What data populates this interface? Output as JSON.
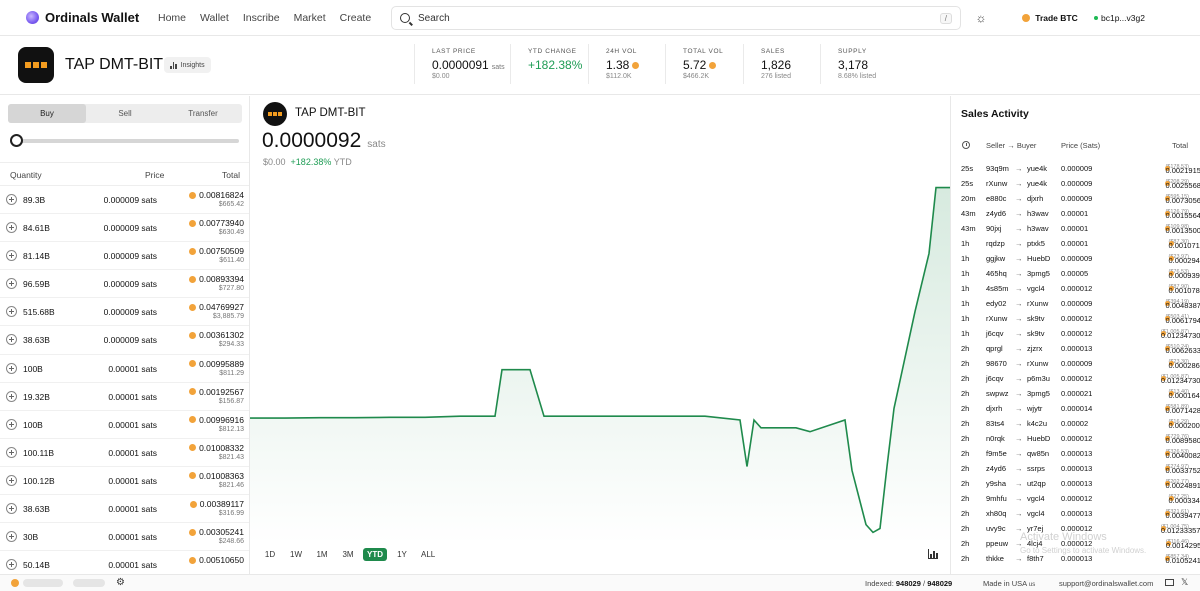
{
  "nav": {
    "brand": "Ordinals Wallet",
    "links": [
      "Home",
      "Wallet",
      "Inscribe",
      "Market",
      "Create"
    ],
    "search_placeholder": "Search",
    "search_shortcut": "/",
    "trade_label": "Trade BTC",
    "wallet_address": "bc1p...v3g2"
  },
  "token": {
    "name": "TAP DMT-BIT",
    "insights_label": "Insights"
  },
  "stats": [
    {
      "label": "LAST PRICE",
      "value": "0.0000091",
      "unit": "sats",
      "sub": "$0.00"
    },
    {
      "label": "YTD CHANGE",
      "value": "+182.38%",
      "unit": "",
      "sub": ""
    },
    {
      "label": "24H VOL",
      "value": "1.38",
      "unit": "",
      "sub": "$112.0K"
    },
    {
      "label": "TOTAL VOL",
      "value": "5.72",
      "unit": "",
      "sub": "$466.2K"
    },
    {
      "label": "SALES",
      "value": "1,826",
      "unit": "",
      "sub": "276 listed"
    },
    {
      "label": "SUPPLY",
      "value": "3,178",
      "unit": "",
      "sub": "8.68% listed"
    }
  ],
  "trade_tabs": [
    "Buy",
    "Sell",
    "Transfer"
  ],
  "orderbook": {
    "headers": {
      "quantity": "Quantity",
      "price": "Price",
      "total": "Total"
    },
    "rows": [
      {
        "qty": "89.3B",
        "price": "0.000009 sats",
        "total": "0.00816824",
        "usd": "$665.42"
      },
      {
        "qty": "84.61B",
        "price": "0.000009 sats",
        "total": "0.00773940",
        "usd": "$630.49"
      },
      {
        "qty": "81.14B",
        "price": "0.000009 sats",
        "total": "0.00750509",
        "usd": "$611.40"
      },
      {
        "qty": "96.59B",
        "price": "0.000009 sats",
        "total": "0.00893394",
        "usd": "$727.80"
      },
      {
        "qty": "515.68B",
        "price": "0.000009 sats",
        "total": "0.04769927",
        "usd": "$3,885.79"
      },
      {
        "qty": "38.63B",
        "price": "0.000009 sats",
        "total": "0.00361302",
        "usd": "$294.33"
      },
      {
        "qty": "100B",
        "price": "0.00001 sats",
        "total": "0.00995889",
        "usd": "$811.29"
      },
      {
        "qty": "19.32B",
        "price": "0.00001 sats",
        "total": "0.00192567",
        "usd": "$156.87"
      },
      {
        "qty": "100B",
        "price": "0.00001 sats",
        "total": "0.00996916",
        "usd": "$812.13"
      },
      {
        "qty": "100.11B",
        "price": "0.00001 sats",
        "total": "0.01008332",
        "usd": "$821.43"
      },
      {
        "qty": "100.12B",
        "price": "0.00001 sats",
        "total": "0.01008363",
        "usd": "$821.46"
      },
      {
        "qty": "38.63B",
        "price": "0.00001 sats",
        "total": "0.00389117",
        "usd": "$316.99"
      },
      {
        "qty": "30B",
        "price": "0.00001 sats",
        "total": "0.00305241",
        "usd": "$248.66"
      },
      {
        "qty": "50.14B",
        "price": "0.00001 sats",
        "total": "0.00510650",
        "usd": ""
      }
    ]
  },
  "chart": {
    "title": "TAP DMT-BIT",
    "price": "0.0000092",
    "unit": "sats",
    "usd": "$0.00",
    "change": "+182.38%",
    "change_suffix": "YTD",
    "ranges": [
      "1D",
      "1W",
      "1M",
      "3M",
      "YTD",
      "1Y",
      "ALL"
    ],
    "active_range": "YTD",
    "line_color": "#1f8a4c"
  },
  "chart_data": {
    "type": "area",
    "x": [
      0,
      5,
      10,
      15,
      20,
      25,
      30,
      35,
      36,
      40,
      42,
      45,
      47,
      50,
      55,
      60,
      65,
      70,
      71,
      72,
      73,
      74,
      75,
      78,
      80,
      85,
      86,
      87,
      88,
      89,
      90,
      91,
      92,
      95,
      97,
      98,
      99,
      100
    ],
    "values": [
      3.25e-06,
      3.25e-06,
      3.26e-06,
      3.26e-06,
      3.27e-06,
      3.27e-06,
      3.3e-06,
      3.3e-06,
      4.5e-06,
      4.5e-06,
      3.3e-06,
      3.3e-06,
      3.3e-06,
      3.3e-06,
      3.3e-06,
      3.3e-06,
      3.3e-06,
      3.2e-06,
      2e-06,
      3.2e-06,
      3e-06,
      3e-06,
      3e-06,
      3e-06,
      2.9e-06,
      3.2e-06,
      1.9e-06,
      1.2e-06,
      5e-07,
      3e-07,
      4e-07,
      2e-06,
      3.5e-06,
      6e-06,
      7.5e-06,
      9.2e-06,
      9.2e-06,
      9.2e-06
    ],
    "xlim": [
      0,
      100
    ],
    "ylim": [
      0,
      9.5e-06
    ],
    "grid": false,
    "legend": "none"
  },
  "sales": {
    "title": "Sales Activity",
    "headers": {
      "seller_buyer": "Seller → Buyer",
      "price": "Price (Sats)",
      "total": "Total"
    },
    "rows": [
      {
        "t": "25s",
        "s": "93q9m",
        "b": "yue4k",
        "p": "0.000009",
        "total": "0.00219153",
        "usd": "($178.53)"
      },
      {
        "t": "25s",
        "s": "rXunw",
        "b": "yue4k",
        "p": "0.000009",
        "total": "0.00255681",
        "usd": "($208.29)"
      },
      {
        "t": "20m",
        "s": "e880c",
        "b": "djxrh",
        "p": "0.000009",
        "total": "0.00730561",
        "usd": "($595.15)"
      },
      {
        "t": "43m",
        "s": "z4yd6",
        "b": "h3wav",
        "p": "0.00001",
        "total": "0.00155640",
        "usd": "($126.79)"
      },
      {
        "t": "43m",
        "s": "90jxj",
        "b": "h3wav",
        "p": "0.00001",
        "total": "0.00135001",
        "usd": "($109.98)"
      },
      {
        "t": "1h",
        "s": "rqdzp",
        "b": "ptxk5",
        "p": "0.00001",
        "total": "0.00107167",
        "usd": "($87.30)"
      },
      {
        "t": "1h",
        "s": "ggjkw",
        "b": "HuebD",
        "p": "0.000009",
        "total": "0.00029426",
        "usd": "($23.97)"
      },
      {
        "t": "1h",
        "s": "465hq",
        "b": "3pmg5",
        "p": "0.00005",
        "total": "0.00093949",
        "usd": "($76.53)"
      },
      {
        "t": "1h",
        "s": "4s85m",
        "b": "vgcl4",
        "p": "0.000012",
        "total": "0.00107897",
        "usd": "($87.90)"
      },
      {
        "t": "1h",
        "s": "edy02",
        "b": "rXunw",
        "p": "0.000009",
        "total": "0.00483877",
        "usd": "($394.19)"
      },
      {
        "t": "1h",
        "s": "rXunw",
        "b": "sk9tv",
        "p": "0.000012",
        "total": "0.00617949",
        "usd": "($503.41)"
      },
      {
        "t": "1h",
        "s": "j6cqv",
        "b": "sk9tv",
        "p": "0.000012",
        "total": "0.01234730",
        "usd": "($1,005.87)"
      },
      {
        "t": "2h",
        "s": "qprgl",
        "b": "zjzrx",
        "p": "0.000013",
        "total": "0.00626339",
        "usd": "($510.24)"
      },
      {
        "t": "2h",
        "s": "98670",
        "b": "rXunw",
        "p": "0.000009",
        "total": "0.00028600",
        "usd": "($23.30)"
      },
      {
        "t": "2h",
        "s": "j6cqv",
        "b": "p6m3u",
        "p": "0.000012",
        "total": "0.01234730",
        "usd": "($1,005.87)"
      },
      {
        "t": "2h",
        "s": "swpwz",
        "b": "3pmg5",
        "p": "0.000021",
        "total": "0.00016454",
        "usd": "($13.40)"
      },
      {
        "t": "2h",
        "s": "djxrh",
        "b": "wjytr",
        "p": "0.000014",
        "total": "0.00714285",
        "usd": "($581.89)"
      },
      {
        "t": "2h",
        "s": "83ts4",
        "b": "k4c2u",
        "p": "0.00002",
        "total": "0.00020000",
        "usd": "($16.29)"
      },
      {
        "t": "2h",
        "s": "n0rqk",
        "b": "HuebD",
        "p": "0.000012",
        "total": "0.00895804",
        "usd": "($729.76)"
      },
      {
        "t": "2h",
        "s": "f9m5e",
        "b": "qw85n",
        "p": "0.000013",
        "total": "0.00400822",
        "usd": "($326.53)"
      },
      {
        "t": "2h",
        "s": "z4yd6",
        "b": "ssrps",
        "p": "0.000013",
        "total": "0.00337529",
        "usd": "($274.97)"
      },
      {
        "t": "2h",
        "s": "y9sha",
        "b": "ut2qp",
        "p": "0.000013",
        "total": "0.00248910",
        "usd": "($202.77)"
      },
      {
        "t": "2h",
        "s": "9mhfu",
        "b": "vgcl4",
        "p": "0.000012",
        "total": "0.00033450",
        "usd": "($27.25)"
      },
      {
        "t": "2h",
        "s": "xh80q",
        "b": "vgcl4",
        "p": "0.000013",
        "total": "0.00394779",
        "usd": "($321.61)"
      },
      {
        "t": "2h",
        "s": "uvy9c",
        "b": "yr7ej",
        "p": "0.000012",
        "total": "0.01233357",
        "usd": "($1,004.75)"
      },
      {
        "t": "2h",
        "s": "ppeuw",
        "b": "4lcj4",
        "p": "0.000012",
        "total": "0.00142957",
        "usd": "($116.46)"
      },
      {
        "t": "2h",
        "s": "thkke",
        "b": "f8th7",
        "p": "0.000013",
        "total": "0.01052415",
        "usd": "($857.34)"
      }
    ]
  },
  "watermark": {
    "line1": "Activate Windows",
    "line2": "Go to Settings to activate Windows."
  },
  "footer": {
    "indexed_label": "Indexed:",
    "indexed_a": "948029",
    "indexed_sep": "/",
    "indexed_b": "948029",
    "made_in": "Made in USA",
    "made_in_flag": "us",
    "support": "support@ordinalswallet.com"
  }
}
